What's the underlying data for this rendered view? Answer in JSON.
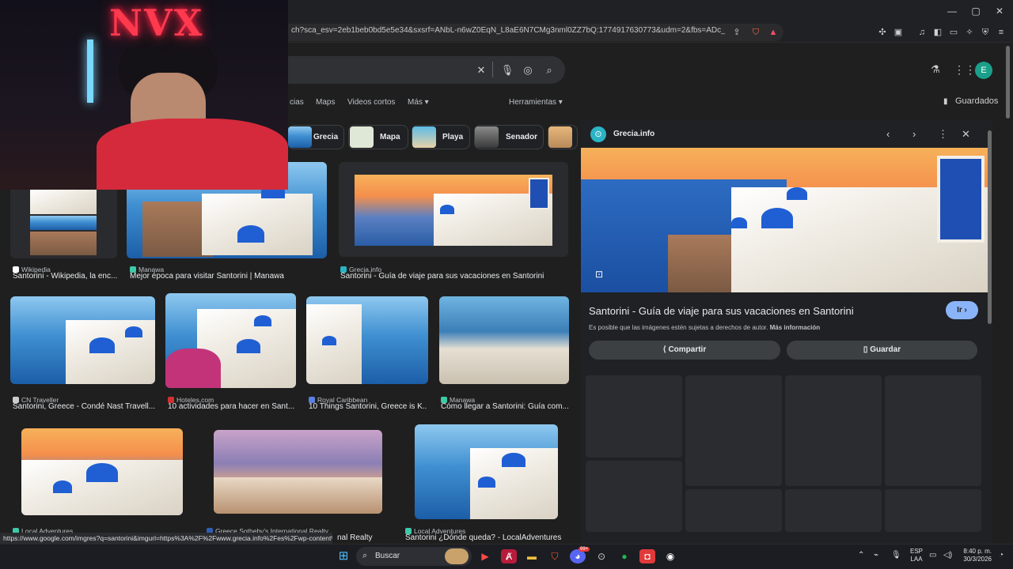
{
  "browser": {
    "url": "ch?sca_esv=2eb1beb0bd5e5e34&sxsrf=ANbL-n6wZ0EqN_L8aE6N7CMg3nml0ZZ7bQ:1774917630773&udm=2&fbs=ADc_l-bpk8W4...",
    "status_url": "https://www.google.com/imgres?q=santorini&imgurl=https%3A%2F%2Fwww.grecia.info%2Fes%2Fwp-content%2Fu...",
    "window_controls": [
      "—",
      "▢",
      "✕"
    ]
  },
  "google": {
    "account_initial": "E",
    "tabs": [
      "cias",
      "Maps",
      "Videos cortos",
      "Más ▾"
    ],
    "tools_label": "Herramientas ▾",
    "saved_label": "Guardados",
    "chips": [
      {
        "label": "Grecia"
      },
      {
        "label": "Mapa"
      },
      {
        "label": "Playa"
      },
      {
        "label": "Senador"
      }
    ]
  },
  "results": [
    {
      "source": "Wikipedia",
      "caption": "Santorini - Wikipedia, la enc...",
      "fav_color": "#ffffff"
    },
    {
      "source": "Manawa",
      "caption": "Mejor época para visitar Santorini | Manawa",
      "fav_color": "#3ec9a7"
    },
    {
      "source": "Grecia.info",
      "caption": "Santorini - Guía de viaje para sus vacaciones en Santorini",
      "fav_color": "#2bb4c6"
    },
    {
      "source": "CN Traveller",
      "caption": "Santorini, Greece - Condé Nast Travell...",
      "fav_color": "#cccccc"
    },
    {
      "source": "Hoteles.com",
      "caption": "10 actividades para hacer en Sant...",
      "fav_color": "#d32f2f"
    },
    {
      "source": "Royal Caribbean",
      "caption": "10 Things Santorini, Greece is K...",
      "fav_color": "#5b7fe0"
    },
    {
      "source": "Manawa",
      "caption": "Cómo llegar a Santorini: Guía com...",
      "fav_color": "#3ec9a7"
    },
    {
      "source": "Local Adventures",
      "caption": "",
      "fav_color": "#3ec9a7"
    },
    {
      "source": "Greece Sotheby's International Realty",
      "caption": "nal Realty",
      "fav_color": "#2f5fb3"
    },
    {
      "source": "Local Adventures",
      "caption": "Santorini ¿Dónde queda? - LocalAdventures",
      "fav_color": "#3ec9a7"
    }
  ],
  "panel": {
    "site": "Grecia.info",
    "title": "Santorini - Guía de viaje para sus vacaciones en Santorini",
    "go_label": "Ir ›",
    "copyright": "Es posible que las imágenes estén sujetas a derechos de autor.",
    "more_info": "Más información",
    "share_label": "Compartir",
    "save_label": "Guardar"
  },
  "webcam": {
    "neon_text": "NVX"
  },
  "taskbar": {
    "search_label": "Buscar",
    "lang": "ESP",
    "lang2": "LAA",
    "time": "8:40 p. m.",
    "date": "30/3/2026",
    "badge": "99+"
  }
}
